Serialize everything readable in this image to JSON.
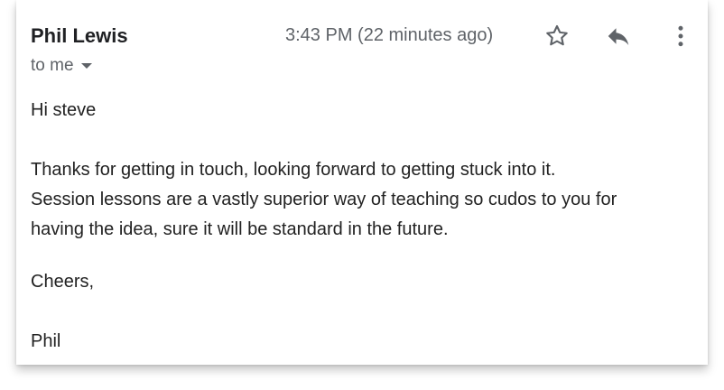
{
  "message": {
    "sender_name": "Phil Lewis",
    "timestamp": "3:43 PM (22 minutes ago)",
    "recipient": "to me",
    "greeting": "Hi steve",
    "paragraph_lines": [
      "Thanks for getting in touch, looking forward to getting stuck into it.",
      "Session lessons are a vastly superior way of teaching so cudos to you for",
      "having the idea, sure it will be standard in the future."
    ],
    "signoff": "Cheers,",
    "signature": "Phil"
  },
  "actions": {
    "star_icon": "star-outline-icon",
    "reply_icon": "reply-icon",
    "more_icon": "more-vert-icon"
  },
  "colors": {
    "text_primary": "#202124",
    "text_secondary": "#5f6368",
    "icon": "#5f6368"
  }
}
